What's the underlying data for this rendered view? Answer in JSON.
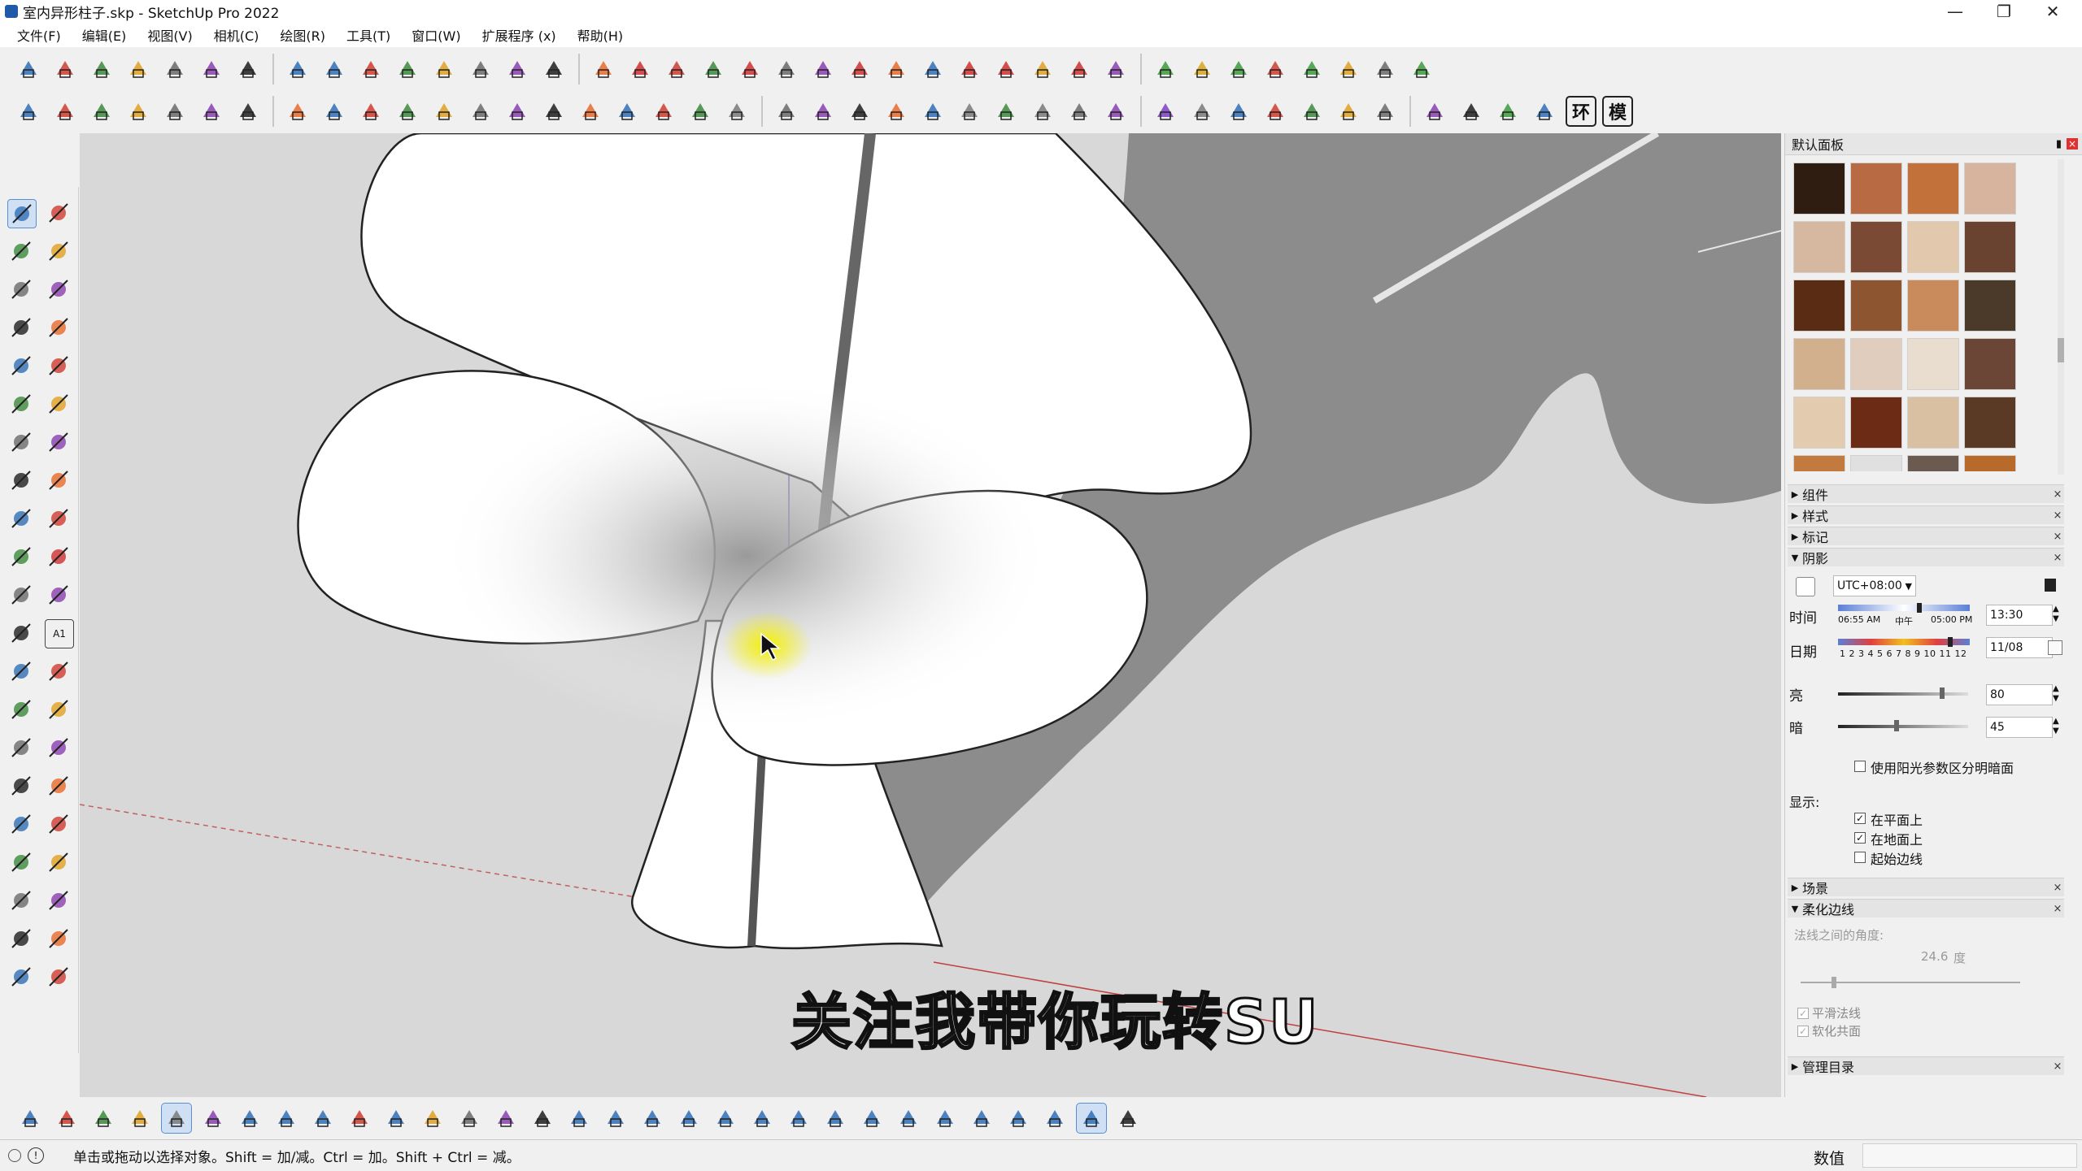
{
  "window": {
    "title": "室内异形柱子.skp - SketchUp Pro 2022",
    "controls": [
      "—",
      "❐",
      "✕"
    ]
  },
  "menu": [
    "文件(F)",
    "编辑(E)",
    "视图(V)",
    "相机(C)",
    "绘图(R)",
    "工具(T)",
    "窗口(W)",
    "扩展程序 (x)",
    "帮助(H)"
  ],
  "toolbar_row1_icons": [
    "iso-view-icon",
    "top-view-icon",
    "front-view-icon",
    "right-view-icon",
    "back-view-icon",
    "style-shaded-icon",
    "style-texture-icon",
    "cloud-tool-icon",
    "cloud-upload-icon",
    "curve-icon",
    "curve2-icon",
    "scale-icon",
    "nodes-icon",
    "refresh-icon",
    "target-icon",
    "su-app-icon",
    "red-box-icon",
    "paint-bucket-icon",
    "flower-icon",
    "red-cube-icon",
    "magnet-icon",
    "u-turn-icon",
    "ruler-red-icon",
    "ruler-icon",
    "ruler2-icon",
    "gear-red-icon",
    "stack-red-icon",
    "stack2-icon",
    "layers-red-icon",
    "rainbow-icon",
    "cube-green-icon",
    "cube-yellow-icon",
    "cube-green2-icon",
    "broom-icon",
    "gear-green-icon",
    "undo-curve-icon",
    "report-icon",
    "play-green-icon"
  ],
  "toolbar_row2_icons": [
    "follow-me-icon",
    "orbit-sphere-icon",
    "push-shape-icon",
    "torus-icon",
    "shell-icon",
    "frame-icon",
    "rotate-loop-icon",
    "plane-icon",
    "plate-icon",
    "window-icon",
    "window2-icon",
    "door-icon",
    "gear-house-icon",
    "umbrella-icon",
    "ring-icon",
    "cone-icon",
    "t-bar-icon",
    "sun-burst-icon",
    "dome-icon",
    "sphere-grey-icon",
    "truck-icon",
    "box-icon",
    "box2-icon",
    "grass-icon",
    "hatch-icon",
    "grid-icon",
    "panel-icon",
    "grid2-icon",
    "copy-icon",
    "fill-icon",
    "purple-p-icon",
    "target-grey-icon",
    "video-icon",
    "camera-icon",
    "y-axis-icon",
    "settings-icon",
    "package-icon",
    "stairs-icon",
    "dropper-icon",
    "pin-green-icon",
    "table-icon",
    "env-icon",
    "model-icon"
  ],
  "toolbar_row2_labels": {
    "env": "环",
    "model": "模"
  },
  "left_tools": [
    "select-arrow-icon",
    "orbit-select-icon",
    "paint-icon",
    "eraser-icon",
    "component-icon",
    "tag-icon",
    "pencil-icon",
    "freehand-icon",
    "rectangle-icon",
    "rotated-rect-icon",
    "circle-icon",
    "polygon-icon",
    "arc-icon",
    "arc2-icon",
    "arc3-icon",
    "pie-icon",
    "move-icon",
    "push-pull-icon",
    "rotate-icon",
    "follow-me-red-icon",
    "scale-tool-icon",
    "offset-icon",
    "tape-icon",
    "text-icon",
    "protractor-icon",
    "3d-text-icon",
    "axes-icon",
    "dimension-icon",
    "orbit-tool-icon",
    "pan-icon",
    "zoom-icon",
    "zoom-window-icon",
    "zoom-extents-icon",
    "previous-view-icon",
    "position-camera-icon",
    "look-around-icon",
    "walk-icon",
    "section-plane-icon",
    "sandbox-icon",
    "sandbox2-icon",
    "layers-tool-icon",
    "stamp-icon"
  ],
  "left_text_tool_label": "A1",
  "subtitle": "关注我带你玩转SU",
  "tray": {
    "title": "默认面板",
    "pin": "▮",
    "sections_collapsed_top": [
      "组件",
      "样式",
      "标记"
    ],
    "shadow_section": "阴影",
    "timezone": "UTC+08:00",
    "time_label": "时间",
    "time_start": "06:55 AM",
    "time_mid": "中午",
    "time_end": "05:00 PM",
    "time_value": "13:30",
    "time_fraction": 0.62,
    "date_label": "日期",
    "date_ticks": "1 2 3 4 5 6 7 8 9 10 11 12",
    "date_value": "11/08",
    "date_fraction": 0.85,
    "light_label": "亮",
    "light_value": "80",
    "light_fraction": 0.8,
    "dark_label": "暗",
    "dark_value": "45",
    "dark_fraction": 0.45,
    "use_sun_label": "使用阳光参数区分明暗面",
    "display_label": "显示:",
    "on_faces": "在平面上",
    "on_ground": "在地面上",
    "from_edges": "起始边线",
    "scenes_section": "场景",
    "soften_section": "柔化边线",
    "normals_angle_label": "法线之间的角度:",
    "angle_value": "24.6",
    "angle_unit": "度",
    "smooth_normals": "平滑法线",
    "soften_coplanar": "软化共面",
    "manage_section": "管理目录",
    "close_mark": "×"
  },
  "materials": [
    "#2f1d12",
    "#b86b43",
    "#c2713a",
    "#d7b49d",
    "#d6b8a0",
    "#7a4a34",
    "#e2c8ac",
    "#6a4330",
    "#5a2c14",
    "#8e5630",
    "#c98a5c",
    "#4b3a2a",
    "#d2b08e",
    "#e0cdbd",
    "#e9ddd0",
    "#6b4636",
    "#e3cbb0",
    "#6c2b14",
    "#d9c0a2",
    "#5a3a25",
    "#c27a3e",
    "#e0e0e0",
    "#6a5a50",
    "#b86a2a"
  ],
  "bottom_toolbar_icons": [
    "open-icon",
    "badge-icon",
    "export-icon",
    "import-icon",
    "grid-select-icon",
    "flip-icon",
    "line-blue-icon",
    "square-blue-icon",
    "tile-icon",
    "pavilion-icon",
    "circle-blue-icon",
    "wave-icon",
    "slash-icon",
    "scatter-icon",
    "split-icon",
    "box-blue-icon",
    "basket-icon",
    "layers-blue-icon",
    "cube-blue-icon",
    "arrow-blue-icon",
    "plane-blue-icon",
    "download-blue-icon",
    "cube2-blue-icon",
    "frame-blue-icon",
    "door-blue-icon",
    "arc-blue-icon",
    "shape-blue-icon",
    "gear-blue-icon",
    "wand-blue-icon",
    "dots-blue-icon",
    "bow-tie-icon"
  ],
  "status": {
    "message": "单击或拖动以选择对象。Shift = 加/减。Ctrl = 加。Shift + Ctrl = 减。",
    "measure_label": "数值"
  }
}
